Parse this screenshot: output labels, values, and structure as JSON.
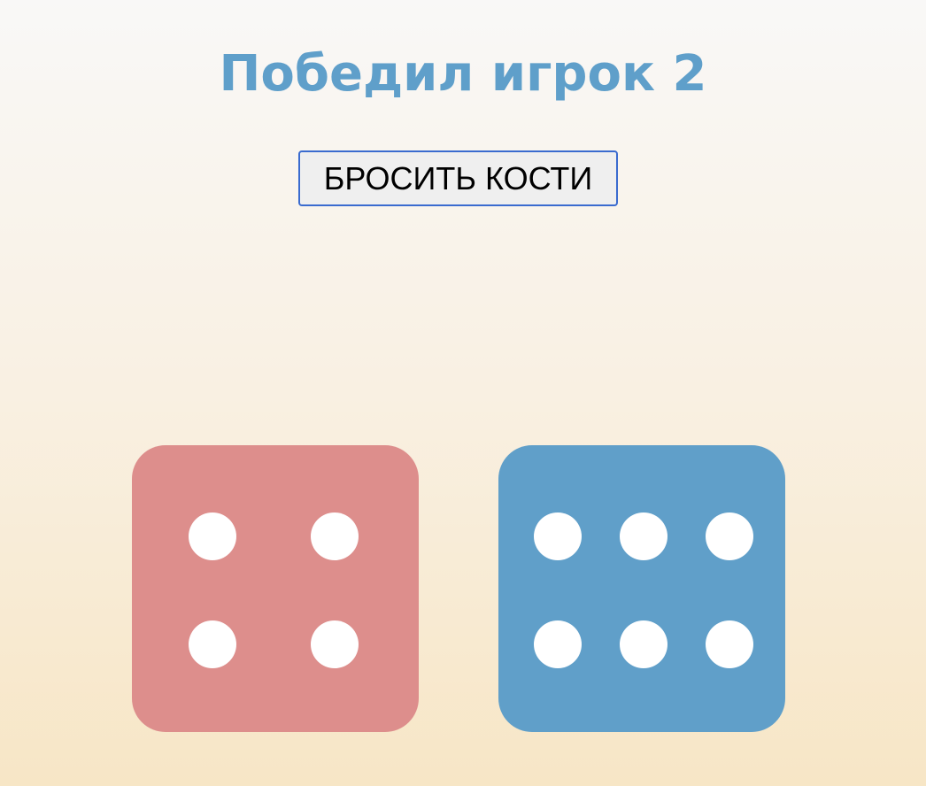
{
  "header": {
    "title": "Победил игрок 2"
  },
  "controls": {
    "roll_button_label": "БРОСИТЬ КОСТИ"
  },
  "dice": [
    {
      "player": 1,
      "value": 4,
      "color": "#dd8e8c"
    },
    {
      "player": 2,
      "value": 6,
      "color": "#609fc9"
    }
  ],
  "colors": {
    "title": "#5f9fca",
    "pip": "#ffffff",
    "button_border": "#3a6bcf"
  }
}
